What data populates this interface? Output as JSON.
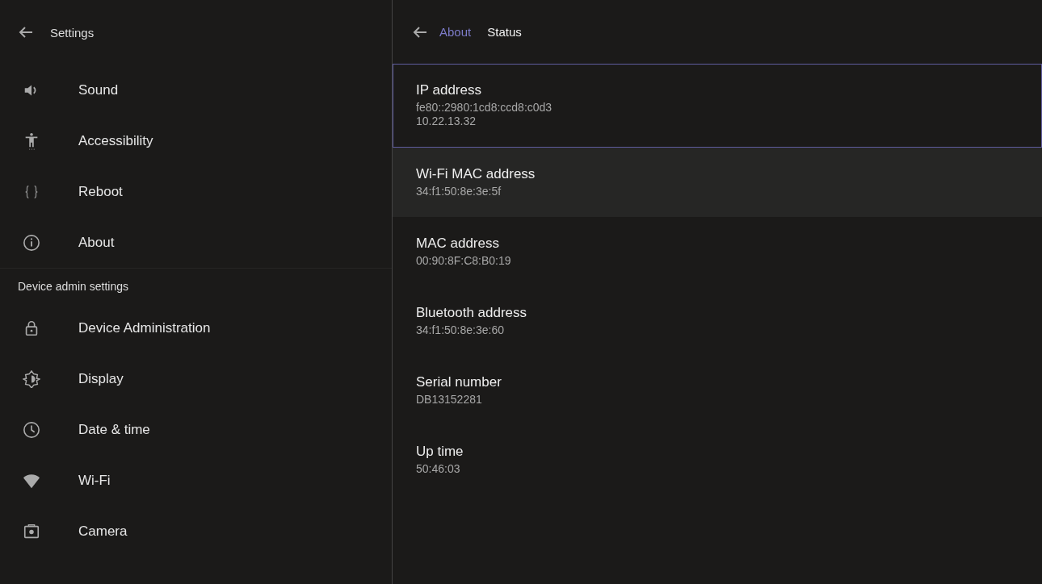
{
  "sidebar": {
    "title": "Settings",
    "items": [
      {
        "label": "Sound"
      },
      {
        "label": "Accessibility"
      },
      {
        "label": "Reboot"
      },
      {
        "label": "About"
      }
    ],
    "section": {
      "title": "Device admin settings",
      "items": [
        {
          "label": "Device Administration"
        },
        {
          "label": "Display"
        },
        {
          "label": "Date & time"
        },
        {
          "label": "Wi-Fi"
        },
        {
          "label": "Camera"
        }
      ]
    }
  },
  "detail": {
    "breadcrumb": [
      {
        "label": "About",
        "kind": "link"
      },
      {
        "label": "Status",
        "kind": "current"
      }
    ],
    "rows": [
      {
        "title": "IP address",
        "values": [
          "fe80::2980:1cd8:ccd8:c0d3",
          "10.22.13.32"
        ],
        "focused": true,
        "highlighted": false
      },
      {
        "title": "Wi-Fi MAC address",
        "values": [
          "34:f1:50:8e:3e:5f"
        ],
        "focused": false,
        "highlighted": true
      },
      {
        "title": "MAC address",
        "values": [
          "00:90:8F:C8:B0:19"
        ],
        "focused": false,
        "highlighted": false
      },
      {
        "title": "Bluetooth address",
        "values": [
          "34:f1:50:8e:3e:60"
        ],
        "focused": false,
        "highlighted": false
      },
      {
        "title": "Serial number",
        "values": [
          "DB13152281"
        ],
        "focused": false,
        "highlighted": false
      },
      {
        "title": "Up time",
        "values": [
          "50:46:03"
        ],
        "focused": false,
        "highlighted": false
      }
    ]
  }
}
